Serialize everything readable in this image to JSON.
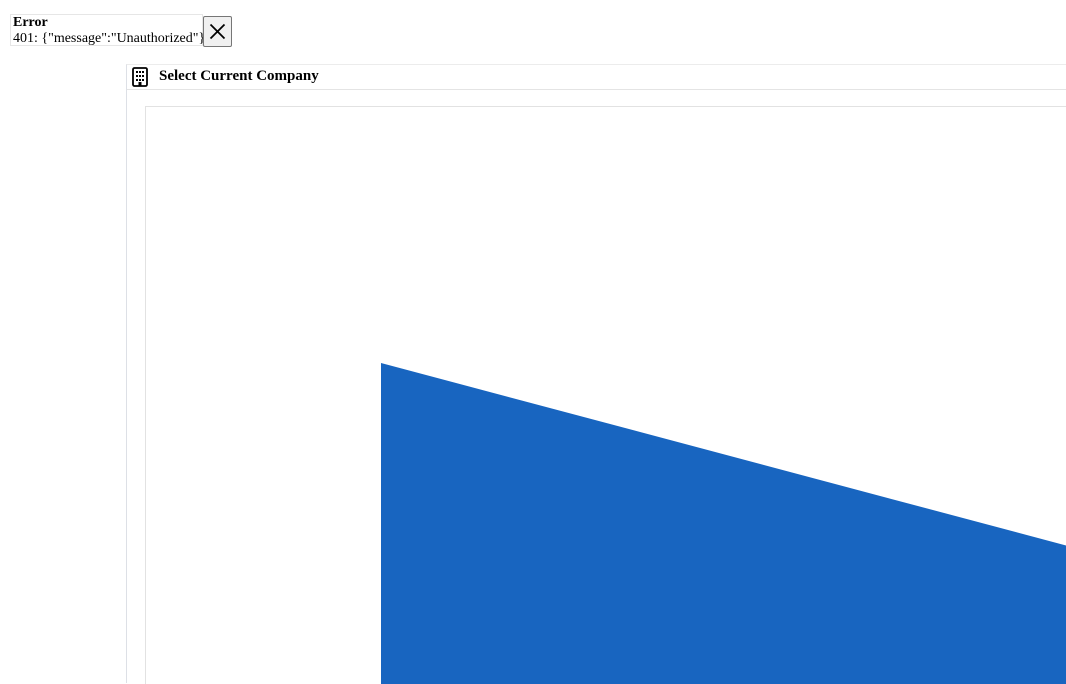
{
  "error": {
    "title": "Error",
    "message": "401: {\"message\":\"Unauthorized\"}",
    "close_icon": "close-icon"
  },
  "panel": {
    "title": "Select Current Company",
    "icon": "building-icon"
  },
  "colors": {
    "shape_fill": "#1865c0"
  }
}
